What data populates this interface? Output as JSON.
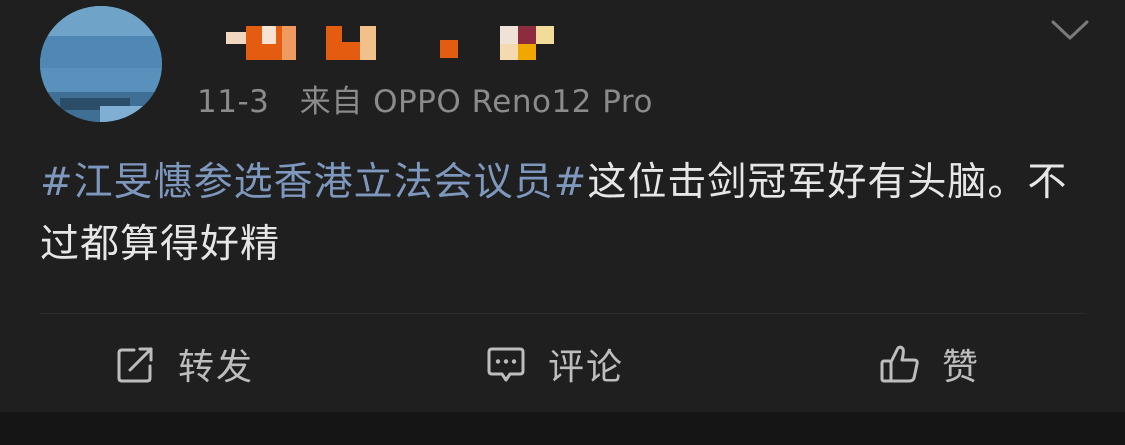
{
  "post": {
    "date": "11-3",
    "source": "来自 OPPO Reno12 Pro",
    "content": {
      "topic": "#江旻憓参选香港立法会议员#",
      "text": "这位击剑冠军好有头脑。不过都算得好精"
    }
  },
  "actions": {
    "repost_label": "转发",
    "comment_label": "评论",
    "like_label": "赞"
  },
  "icons": {
    "menu": "chevron-down-icon",
    "repost": "share-icon",
    "comment": "comment-icon",
    "like": "thumbs-up-icon"
  },
  "colors": {
    "background": "#1f1f1f",
    "text": "#e6e6e6",
    "topic": "#7d97bd",
    "meta": "#8b8b8b",
    "action": "#bdbdbd"
  }
}
